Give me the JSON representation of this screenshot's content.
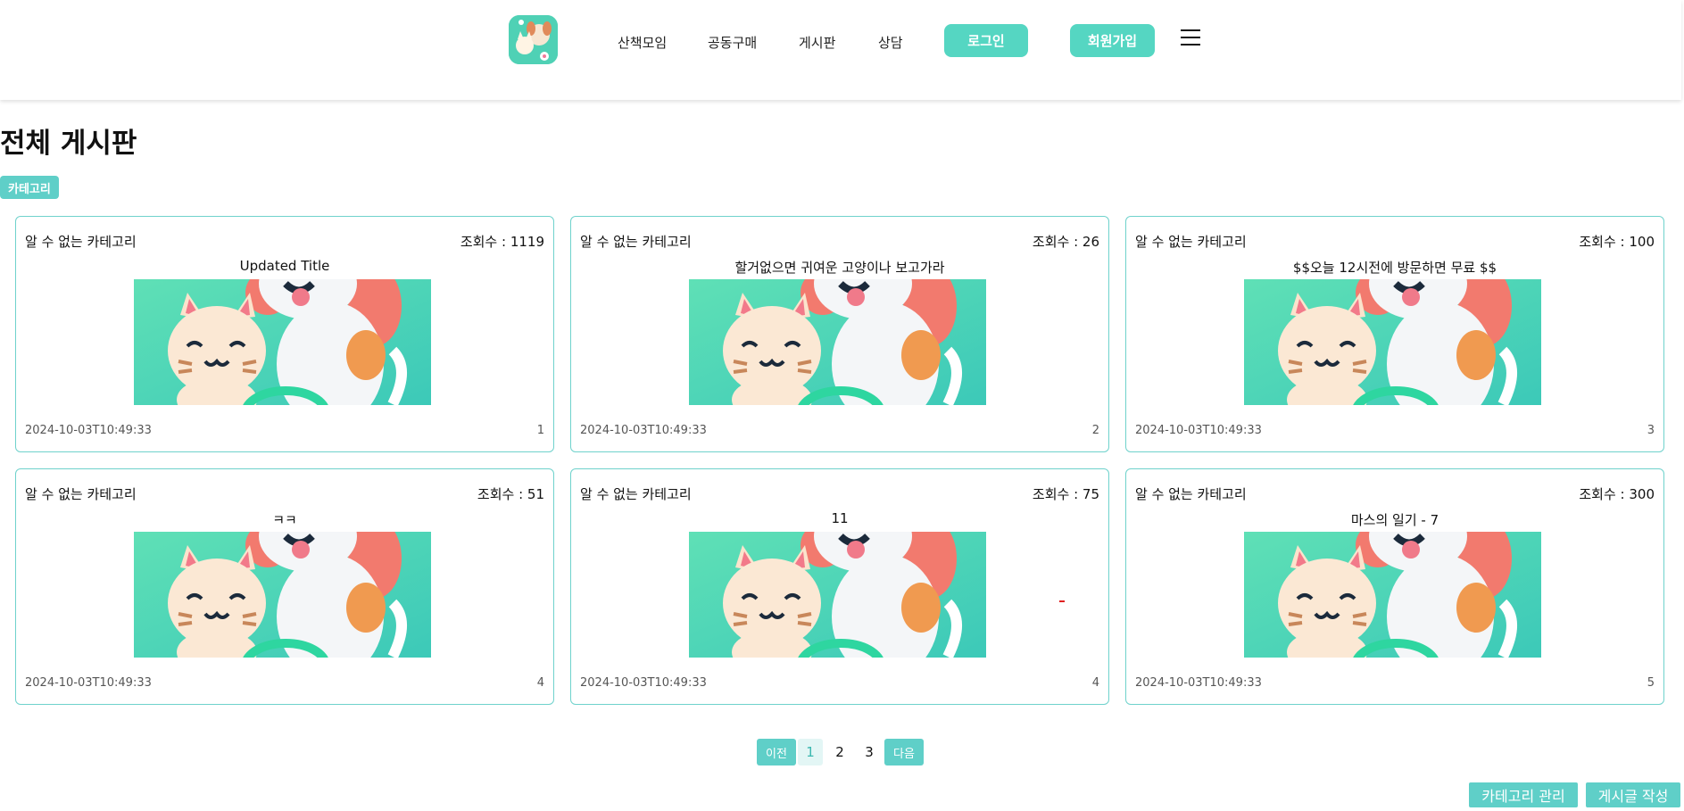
{
  "header": {
    "logo_alt": "pet community logo",
    "nav": [
      {
        "label": "산책모임"
      },
      {
        "label": "공동구매"
      },
      {
        "label": "게시판"
      },
      {
        "label": "상담"
      }
    ],
    "login_label": "로그인",
    "signup_label": "회원가입",
    "menu_icon": "hamburger-icon"
  },
  "page": {
    "title": "전체 게시판",
    "category_label": "카테고리"
  },
  "posts": [
    {
      "category": "알 수 없는 카테고리",
      "views": "조회수 : 1119",
      "title": "Updated Title",
      "date": "2024-10-03T10:49:33",
      "num": "1"
    },
    {
      "category": "알 수 없는 카테고리",
      "views": "조회수 : 26",
      "title": "할거없으면 귀여운 고양이나 보고가라",
      "date": "2024-10-03T10:49:33",
      "num": "2"
    },
    {
      "category": "알 수 없는 카테고리",
      "views": "조회수 : 100",
      "title": "$$오늘 12시전에 방문하면 무료 $$",
      "date": "2024-10-03T10:49:33",
      "num": "3"
    },
    {
      "category": "알 수 없는 카테고리",
      "views": "조회수 : 51",
      "title": "ㅋㅋ",
      "date": "2024-10-03T10:49:33",
      "num": "4"
    },
    {
      "category": "알 수 없는 카테고리",
      "views": "조회수 : 75",
      "title": "11",
      "date": "2024-10-03T10:49:33",
      "num": "4"
    },
    {
      "category": "알 수 없는 카테고리",
      "views": "조회수 : 300",
      "title": "마스의 일기 - 7",
      "date": "2024-10-03T10:49:33",
      "num": "5"
    }
  ],
  "pagination": {
    "prev_label": "이전",
    "next_label": "다음",
    "pages": [
      "1",
      "2",
      "3"
    ],
    "current": "1"
  },
  "actions": {
    "manage_categories_label": "카테고리 관리",
    "write_post_label": "게시글 작성"
  },
  "colors": {
    "accent": "#55d6c2",
    "card_border": "#6fd2cc"
  }
}
